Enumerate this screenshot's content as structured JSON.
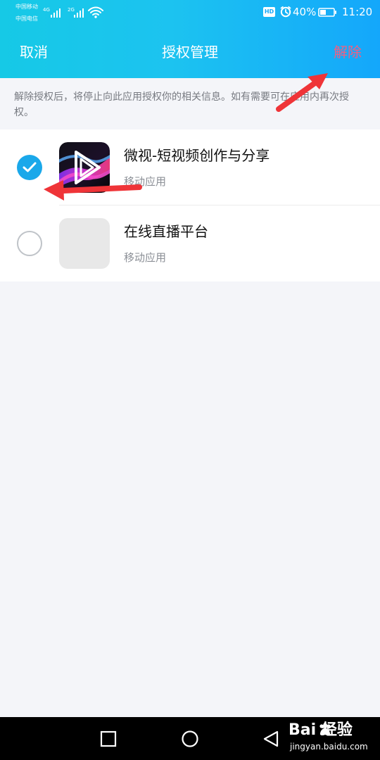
{
  "status_bar": {
    "carrier_1": "中国移动",
    "carrier_2": "中国电信",
    "network_1": "4G",
    "network_2": "2G",
    "hd_badge": "HD",
    "battery": "40%",
    "time": "11:20"
  },
  "nav": {
    "cancel": "取消",
    "title": "授权管理",
    "remove": "解除"
  },
  "description": "解除授权后，将停止向此应用授权你的相关信息。如有需要可在应用内再次授权。",
  "apps": [
    {
      "name": "微视-短视频创作与分享",
      "type": "移动应用",
      "selected": true,
      "icon": "weishi-app-icon"
    },
    {
      "name": "在线直播平台",
      "type": "移动应用",
      "selected": false,
      "icon": "placeholder-app-icon"
    }
  ],
  "watermark": {
    "main": "Bai 经验",
    "sub": "jingyan.baidu.com"
  },
  "colors": {
    "header_start": "#16c9e6",
    "header_end": "#14a7fb",
    "remove_text": "#f15f83",
    "radio_selected": "#1aa8ea",
    "annotation_arrow": "#ef3438"
  }
}
